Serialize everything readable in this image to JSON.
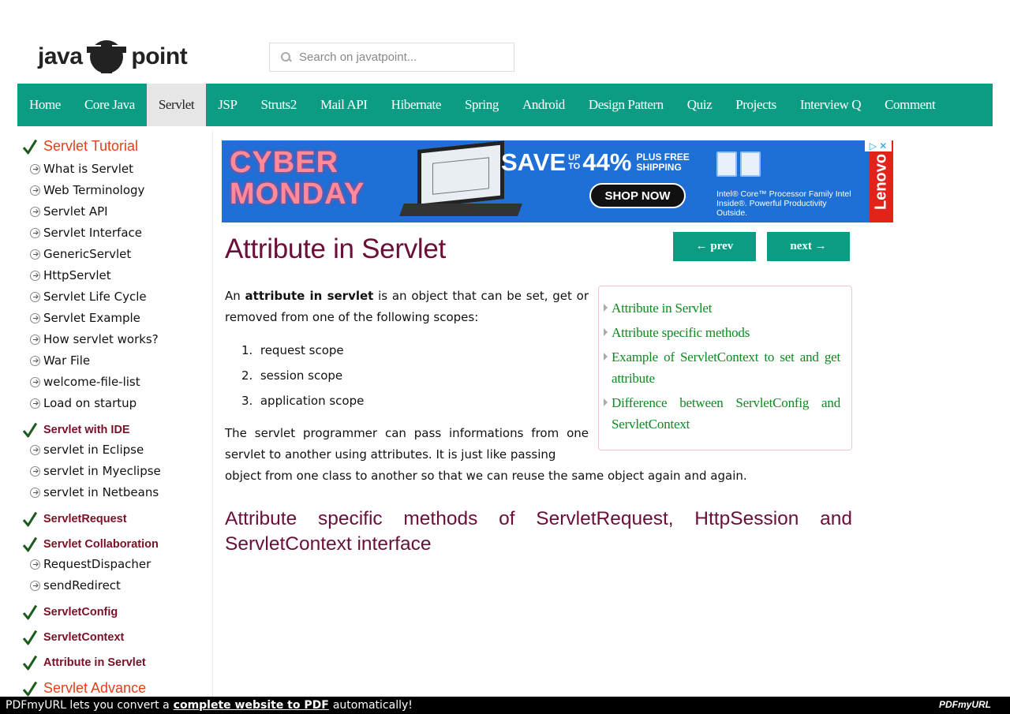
{
  "logo": {
    "left": "java",
    "right": "point"
  },
  "search": {
    "placeholder": "Search on javatpoint..."
  },
  "nav": [
    "Home",
    "Core Java",
    "Servlet",
    "JSP",
    "Struts2",
    "Mail API",
    "Hibernate",
    "Spring",
    "Android",
    "Design Pattern",
    "Quiz",
    "Projects",
    "Interview Q",
    "Comment"
  ],
  "nav_active": "Servlet",
  "sidebar": {
    "sections": [
      {
        "title": "Servlet Tutorial",
        "style": "big",
        "items": [
          "What is Servlet",
          "Web Terminology",
          "Servlet API",
          "Servlet Interface",
          "GenericServlet",
          "HttpServlet",
          "Servlet Life Cycle",
          "Servlet Example",
          "How servlet works?",
          "War File",
          "welcome-file-list",
          "Load on startup"
        ]
      },
      {
        "title": "Servlet with IDE",
        "style": "small",
        "items": [
          "servlet in Eclipse",
          "servlet in Myeclipse",
          "servlet in Netbeans"
        ]
      },
      {
        "title": "ServletRequest",
        "style": "small",
        "items": []
      },
      {
        "title": "Servlet Collaboration",
        "style": "small",
        "items": [
          "RequestDispacher",
          "sendRedirect"
        ]
      },
      {
        "title": "ServletConfig",
        "style": "small",
        "items": []
      },
      {
        "title": "ServletContext",
        "style": "small",
        "items": []
      },
      {
        "title": "Attribute in Servlet",
        "style": "small",
        "items": []
      },
      {
        "title": "Servlet Advance",
        "style": "big",
        "items": []
      }
    ]
  },
  "ad": {
    "line1": "CYBER",
    "line2": "MONDAY",
    "save": "SAVE",
    "upto_1": "UP",
    "upto_2": "TO",
    "percent": "44%",
    "free_1": "PLUS FREE",
    "free_2": "SHIPPING",
    "cta": "SHOP NOW",
    "intel_text": "Intel® Core™ Processor Family Intel Inside®. Powerful Productivity Outside.",
    "brand": "Lenovo",
    "adchoice": "▷ ✕"
  },
  "article": {
    "title": "Attribute in Servlet",
    "prev_label": "← prev",
    "next_label": "next →",
    "intro_pre": "An ",
    "intro_bold": "attribute in servlet",
    "intro_post": " is an object that can be set, get or removed from one of the following scopes:",
    "scopes": [
      "request scope",
      "session scope",
      "application scope"
    ],
    "para2": "The servlet programmer can pass informations from one servlet to another using attributes. It is just like passing",
    "para3": "object from one class to another so that we can reuse the same object again and again.",
    "heading2": "Attribute specific methods of ServletRequest, HttpSession and ServletContext interface"
  },
  "toc": [
    "Attribute in Servlet",
    "Attribute specific methods",
    "Example of ServletContext to set and get attribute",
    "Difference between ServletConfig and ServletContext"
  ],
  "footer": {
    "pre": "PDFmyURL lets you convert a",
    "link": "complete website to PDF",
    "post": "automatically!",
    "brand": "PDFmyURL"
  }
}
